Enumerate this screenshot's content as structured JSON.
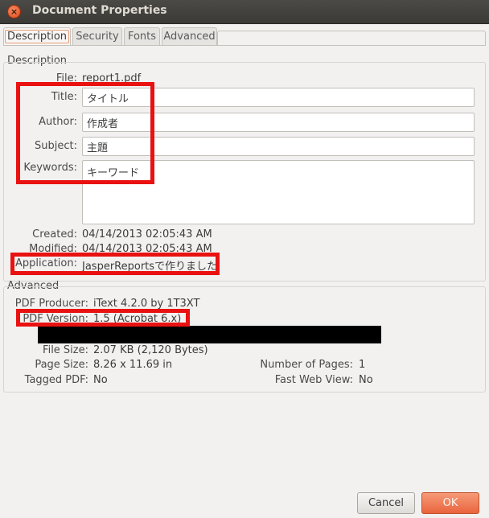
{
  "window": {
    "title": "Document Properties",
    "close_glyph": "×"
  },
  "tabs": [
    {
      "label": "Description",
      "active": true
    },
    {
      "label": "Security",
      "active": false
    },
    {
      "label": "Fonts",
      "active": false
    },
    {
      "label": "Advanced",
      "active": false
    }
  ],
  "description": {
    "section_label": "Description",
    "file_label": "File:",
    "file_value": "report1.pdf",
    "title_label": "Title:",
    "title_value": "タイトル",
    "author_label": "Author:",
    "author_value": "作成者",
    "subject_label": "Subject:",
    "subject_value": "主題",
    "keywords_label": "Keywords:",
    "keywords_value": "キーワード",
    "created_label": "Created:",
    "created_value": "04/14/2013 02:05:43 AM",
    "modified_label": "Modified:",
    "modified_value": "04/14/2013 02:05:43 AM",
    "application_label": "Application:",
    "application_value": "JasperReportsで作りました"
  },
  "advanced": {
    "section_label": "Advanced",
    "producer_label": "PDF Producer:",
    "producer_value": "iText 4.2.0 by 1T3XT",
    "version_label": "PDF Version:",
    "version_value": "1.5 (Acrobat 6.x)",
    "file_size_label": "File Size:",
    "file_size_value": "2.07 KB (2,120 Bytes)",
    "page_size_label": "Page Size:",
    "page_size_value": "8.26 x 11.69 in",
    "tagged_label": "Tagged PDF:",
    "tagged_value": "No",
    "pages_label": "Number of Pages:",
    "pages_value": "1",
    "fast_web_label": "Fast Web View:",
    "fast_web_value": "No"
  },
  "buttons": {
    "cancel": "Cancel",
    "ok": "OK"
  },
  "colors": {
    "annotation_red": "#ea1111",
    "accent_orange": "#e9653d",
    "titlebar": "#3b3a36"
  }
}
